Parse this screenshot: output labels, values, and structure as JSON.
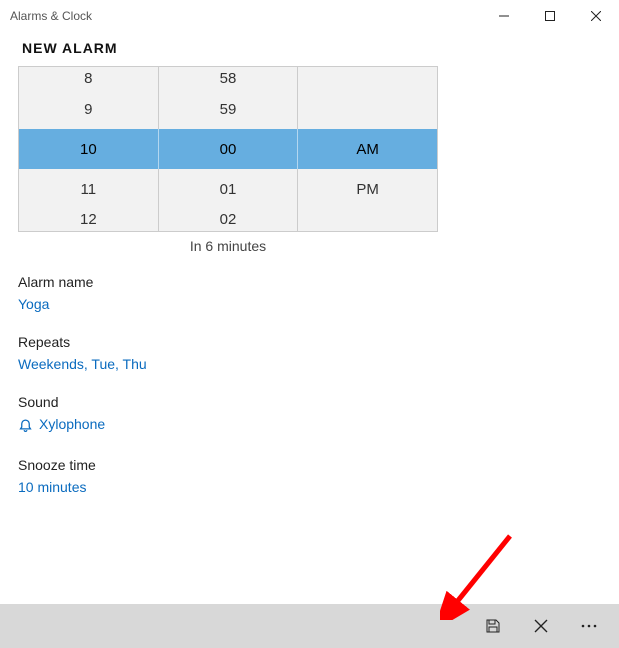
{
  "window": {
    "title": "Alarms & Clock"
  },
  "page_title": "NEW ALARM",
  "picker": {
    "hours": [
      "8",
      "9",
      "10",
      "11",
      "12"
    ],
    "minutes": [
      "58",
      "59",
      "00",
      "01",
      "02"
    ],
    "meridiem": [
      "",
      "",
      "AM",
      "PM",
      ""
    ],
    "selected_index": 2
  },
  "relative_time": "In 6 minutes",
  "fields": {
    "name": {
      "label": "Alarm name",
      "value": "Yoga"
    },
    "repeats": {
      "label": "Repeats",
      "value": "Weekends, Tue, Thu"
    },
    "sound": {
      "label": "Sound",
      "value": "Xylophone"
    },
    "snooze": {
      "label": "Snooze time",
      "value": "10 minutes"
    }
  }
}
